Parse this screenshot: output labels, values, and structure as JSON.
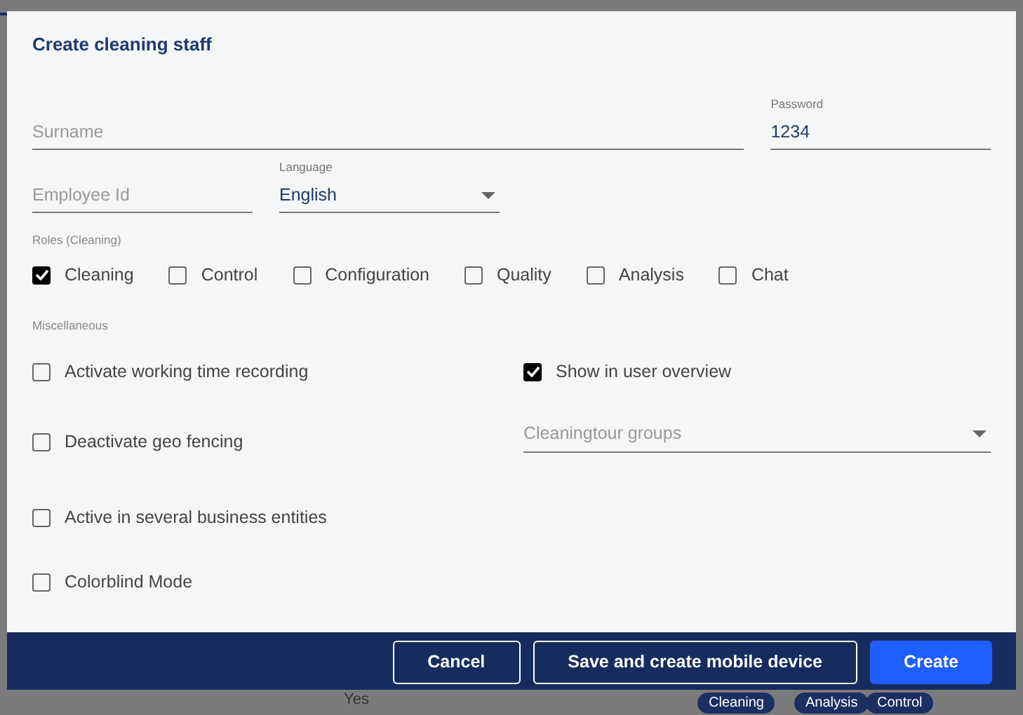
{
  "dialog": {
    "title": "Create cleaning staff",
    "fields": [
      {
        "kind": "text",
        "placeholder": "Surname"
      },
      {
        "kind": "text",
        "label": "Password",
        "value": "1234"
      },
      {
        "kind": "text",
        "placeholder": "Employee Id"
      },
      {
        "kind": "select",
        "label": "Language",
        "value": "English"
      }
    ],
    "roles": {
      "label": "Roles (Cleaning)",
      "options": [
        {
          "label": "Cleaning",
          "checked": true
        },
        {
          "label": "Control",
          "checked": false
        },
        {
          "label": "Configuration",
          "checked": false
        },
        {
          "label": "Quality",
          "checked": false
        },
        {
          "label": "Analysis",
          "checked": false
        },
        {
          "label": "Chat",
          "checked": false
        }
      ]
    },
    "miscellaneous": {
      "label": "Miscellaneous",
      "left": [
        {
          "label": "Activate working time recording",
          "checked": false
        },
        {
          "label": "Deactivate geo fencing",
          "checked": false
        },
        {
          "label": "Active in several business entities",
          "checked": false
        },
        {
          "label": "Colorblind Mode",
          "checked": false
        }
      ],
      "right": [
        {
          "kind": "checkbox",
          "label": "Show in user overview",
          "checked": true
        },
        {
          "kind": "select",
          "placeholder": "Cleaningtour groups"
        }
      ]
    },
    "buttons": [
      {
        "label": "Cancel",
        "kind": "outline"
      },
      {
        "label": "Save and create mobile device",
        "kind": "outline"
      },
      {
        "label": "Create",
        "kind": "primary"
      }
    ]
  },
  "background": {
    "cell": "Yes",
    "tags": [
      "Cleaning",
      "Analysis",
      "Control"
    ]
  }
}
